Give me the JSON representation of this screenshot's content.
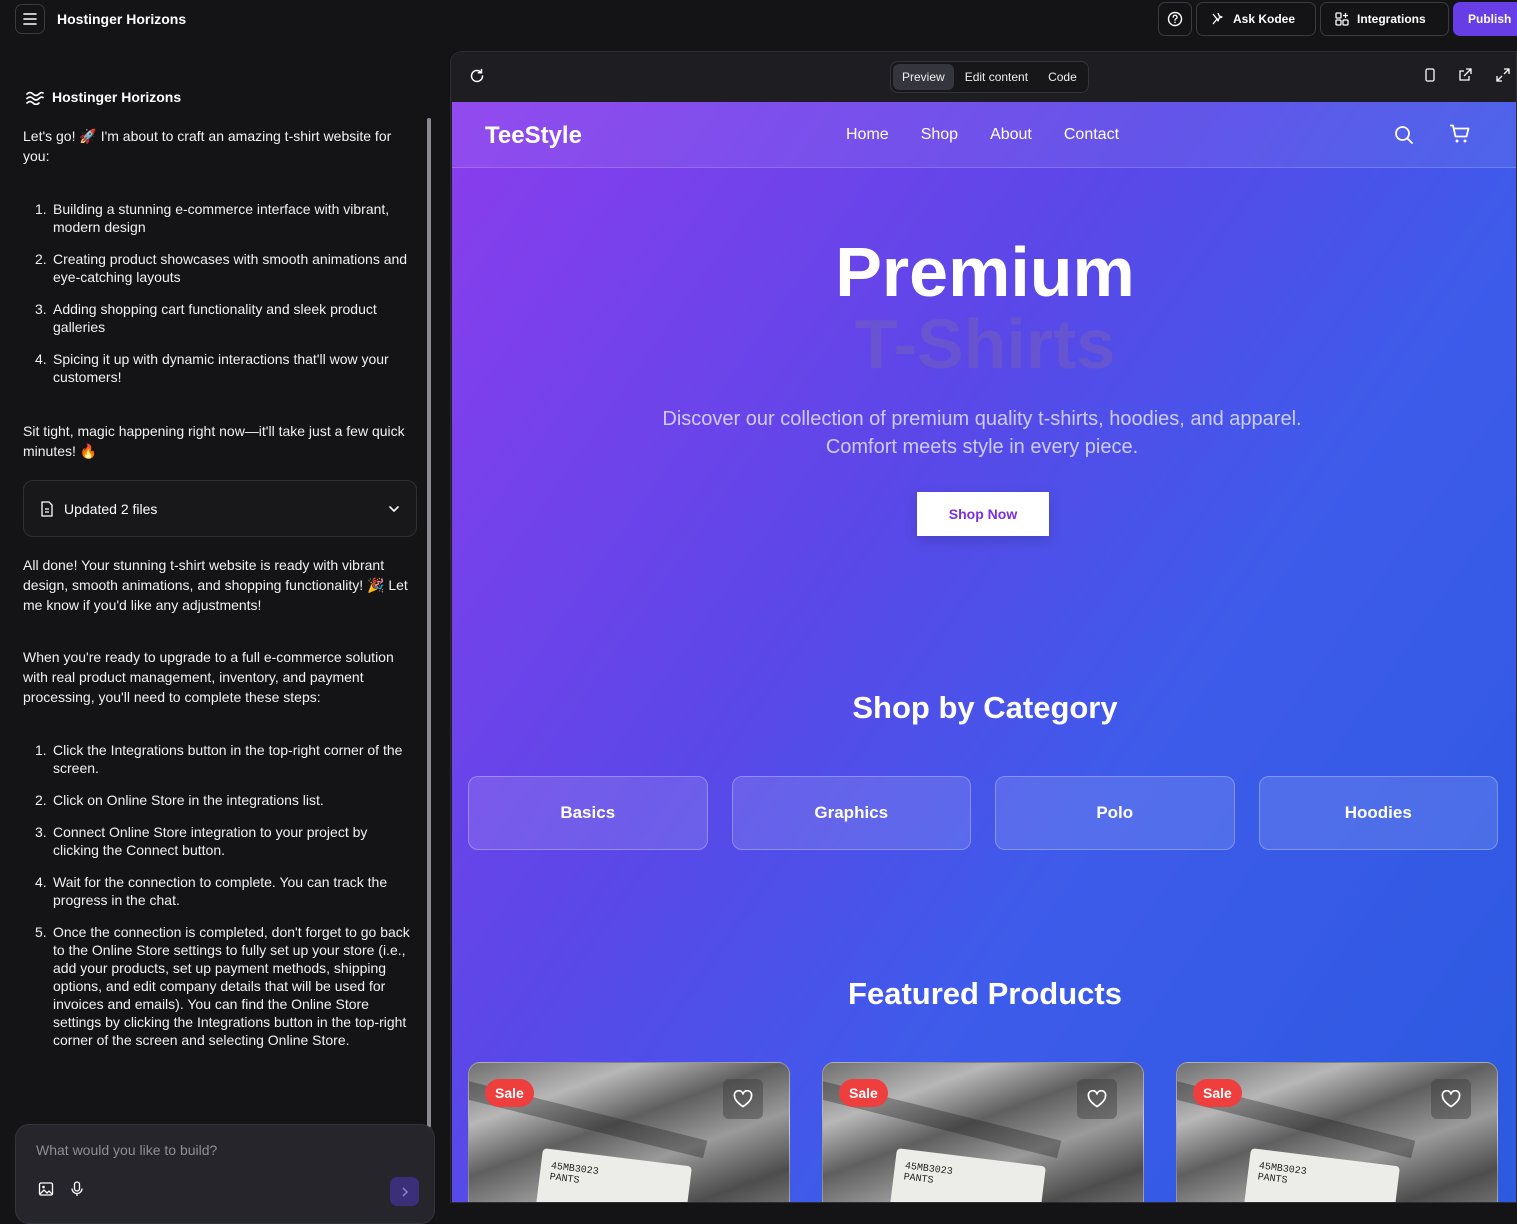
{
  "app": {
    "brand": "Hostinger Horizons",
    "ask_kodee": "Ask Kodee",
    "integrations": "Integrations",
    "publish": "Publish"
  },
  "chat": {
    "header": "Hostinger Horizons",
    "intro": "Let's go! 🚀 I'm about to craft an amazing t-shirt website for you:",
    "plan": [
      {
        "num": "1.",
        "text": "Building a stunning e-commerce interface with vibrant, modern design"
      },
      {
        "num": "2.",
        "text": "Creating product showcases with smooth animations and eye-catching layouts"
      },
      {
        "num": "3.",
        "text": "Adding shopping cart functionality and sleek product galleries"
      },
      {
        "num": "4.",
        "text": "Spicing it up with dynamic interactions that'll wow your customers!"
      }
    ],
    "wait": "Sit tight, magic happening right now—it'll take just a few quick minutes! 🔥",
    "files": "Updated 2 files",
    "done": "All done! Your stunning t-shirt website is ready with vibrant design, smooth animations, and shopping functionality! 🎉 Let me know if you'd like any adjustments!",
    "upgrade": "When you're ready to upgrade to a full e-commerce solution with real product management, inventory, and payment processing, you'll need to complete these steps:",
    "steps": [
      {
        "num": "1.",
        "text": "Click the Integrations button in the top-right corner of the screen."
      },
      {
        "num": "2.",
        "text": "Click on Online Store in the integrations list."
      },
      {
        "num": "3.",
        "text": "Connect Online Store integration to your project by clicking the Connect button."
      },
      {
        "num": "4.",
        "text": "Wait for the connection to complete. You can track the progress in the chat."
      },
      {
        "num": "5.",
        "text": "Once the connection is completed, don't forget to go back to the Online Store settings to fully set up your store (i.e., add your products, set up payment methods, shipping options, and edit company details that will be used for invoices and emails). You can find the Online Store settings by clicking the Integrations button in the top-right corner of the screen and selecting Online Store."
      }
    ],
    "composer_placeholder": "What would you like to build?"
  },
  "preview": {
    "modes": [
      "Preview",
      "Edit content",
      "Code"
    ],
    "active_mode": "Preview"
  },
  "site": {
    "logo": "TeeStyle",
    "nav": [
      "Home",
      "Shop",
      "About",
      "Contact"
    ],
    "hero_title_1": "Premium",
    "hero_title_2": "T-Shirts",
    "hero_sub_1": "Discover our collection of premium quality t-shirts, hoodies, and apparel.",
    "hero_sub_2": "Comfort meets style in every piece.",
    "cta": "Shop Now",
    "category_title": "Shop by Category",
    "categories": [
      "Basics",
      "Graphics",
      "Polo",
      "Hoodies"
    ],
    "featured_title": "Featured Products",
    "products": [
      {
        "badge": "Sale",
        "tag_line1": "45MB3023",
        "tag_line2": "PANTS"
      },
      {
        "badge": "Sale",
        "tag_line1": "45MB3023",
        "tag_line2": "PANTS"
      },
      {
        "badge": "Sale",
        "tag_line1": "45MB3023",
        "tag_line2": "PANTS"
      }
    ]
  },
  "colors": {
    "publish": "#673de6",
    "sale_badge": "#ef3e3e",
    "gradient_start": "#8b3ded",
    "gradient_end": "#2b5ae0"
  },
  "icons": [
    "menu-icon",
    "help-icon",
    "sparkle-icon",
    "grid-icon",
    "waves-icon",
    "file-icon",
    "chevron-down-icon",
    "image-icon",
    "mic-icon",
    "send-icon",
    "refresh-icon",
    "mobile-icon",
    "external-link-icon",
    "expand-icon",
    "search-icon",
    "cart-icon",
    "heart-icon"
  ]
}
